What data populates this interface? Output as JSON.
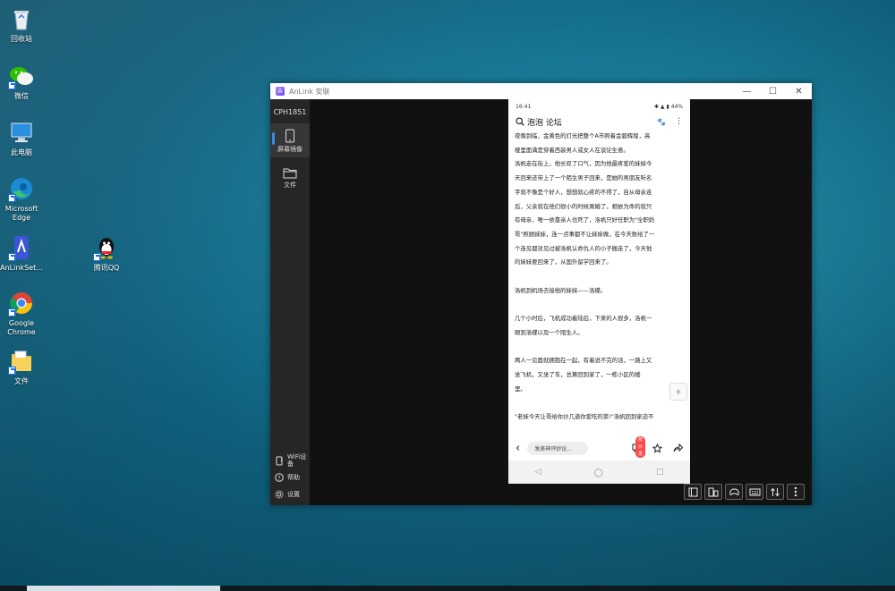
{
  "desktop": {
    "icons": [
      {
        "label": "回收站",
        "icon": "recycle-bin-icon"
      },
      {
        "label": "微信",
        "icon": "wechat-icon"
      },
      {
        "label": "此电脑",
        "icon": "computer-icon"
      },
      {
        "label": "Microsoft Edge",
        "icon": "edge-icon"
      },
      {
        "label": "AnLinkSet...",
        "icon": "anlink-icon"
      },
      {
        "label": "腾讯QQ",
        "icon": "qq-icon"
      },
      {
        "label": "Google Chrome",
        "icon": "chrome-icon"
      },
      {
        "label": "文件",
        "icon": "folder-icon"
      }
    ]
  },
  "window": {
    "title": "AnLink 安联",
    "controls": {
      "minimize": "—",
      "maximize": "☐",
      "close": "✕"
    },
    "sidebar": {
      "device_name": "CPH1851",
      "items": [
        {
          "label": "屏幕镜像",
          "icon": "phone-mirror-icon"
        },
        {
          "label": "文件",
          "icon": "folder-icon"
        }
      ],
      "bottom": [
        {
          "label": "WiFi设备",
          "icon": "wifi-device-icon"
        },
        {
          "label": "帮助",
          "icon": "help-icon"
        },
        {
          "label": "设置",
          "icon": "gear-icon"
        }
      ]
    },
    "toolbar": [
      "fullscreen-icon",
      "phone-screen-icon",
      "gamepad-icon",
      "keyboard-icon",
      "transfer-icon",
      "more-icon"
    ]
  },
  "phone": {
    "status": {
      "time": "16:41",
      "right": "✱ ▲ ▮ 44%"
    },
    "header": {
      "title": "泡泡 论坛",
      "paw": "🐾",
      "more": "⋮"
    },
    "article": {
      "lines": [
        "夜晚到临，金黄色的灯光把整个A市照着金碧辉煌，高",
        "楼里面满是穿着西装男人或女人在谈论生意。",
        "洛帆走在街上，他长叹了口气，因为他最疼爱的妹妹今",
        "天回来还带上了一个陌生男子回来，是她的男朋友听名",
        "字就不像是个好人，想想就心疼的不得了，自从母亲走",
        "后，父亲就在他们很小的时候离婚了，相依为命的就只",
        "有母亲，唯一依靠亲人也死了，洛帆只好任职为\"全职奶",
        "哥\"照顾妹妹，连一点事都不让妹妹做，在今天败给了一",
        "个连见都没见过被洛帆认命仇人的小子搬走了，今天他",
        "的妹妹要回来了，从国外留学回来了。",
        "",
        "洛帆到机场去接他的妹妹——洛蝶。",
        "",
        "几个小时后，飞机成功着陆后，下来的人很多，洛帆一",
        "眼到洛蝶以及一个陌生人。",
        "",
        "两人一见面就拥抱在一起，有着说不完的话，一路上又",
        "坐飞机，又坐了车，总算回到家了，一栋小区的楼",
        "里。",
        "",
        "\"老妹今天让哥给你炒几道你爱吃的菜!\"洛帆回到家迫不"
      ]
    },
    "comment_bar": {
      "back": "‹",
      "placeholder": "发表神评妙论...",
      "badge": "抢沙发"
    },
    "nav": {
      "back": "◁",
      "home": "○",
      "recent": "□"
    }
  }
}
